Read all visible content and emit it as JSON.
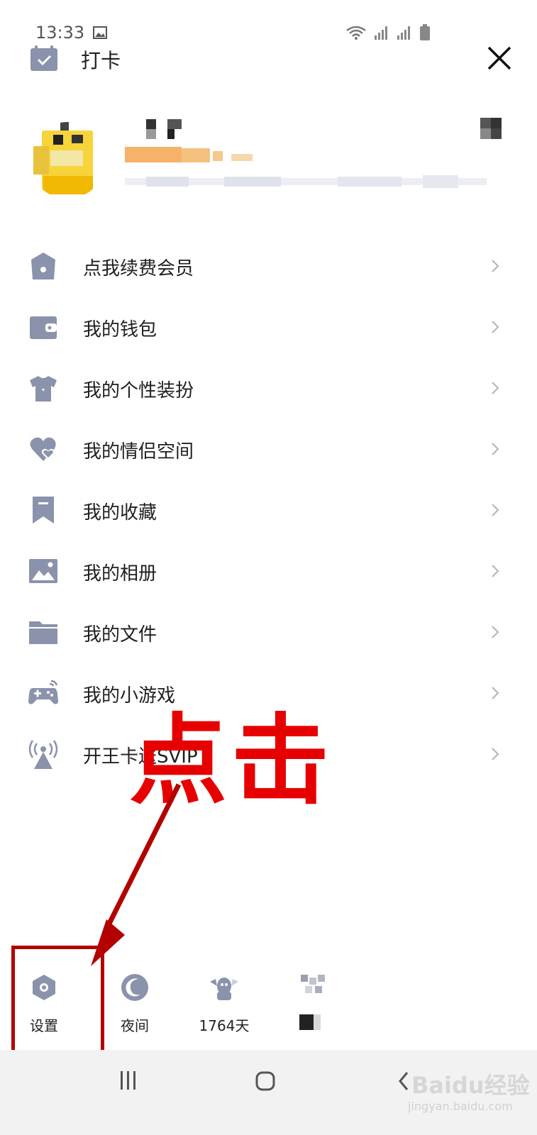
{
  "status_bar": {
    "time": "13:33",
    "icons": [
      "image-icon",
      "wifi-icon",
      "signal-icon",
      "signal-icon",
      "battery-icon"
    ]
  },
  "header": {
    "title": "打卡",
    "checkin_icon": "calendar-check-icon",
    "close_icon": "close-icon"
  },
  "profile": {
    "avatar_icon": "avatar"
  },
  "menu": {
    "items": [
      {
        "label": "点我续费会员",
        "icon": "crown-bag-icon"
      },
      {
        "label": "我的钱包",
        "icon": "wallet-icon"
      },
      {
        "label": "我的个性装扮",
        "icon": "tshirt-icon"
      },
      {
        "label": "我的情侣空间",
        "icon": "hearts-icon"
      },
      {
        "label": "我的收藏",
        "icon": "bookmark-icon"
      },
      {
        "label": "我的相册",
        "icon": "photo-icon"
      },
      {
        "label": "我的文件",
        "icon": "folder-icon"
      },
      {
        "label": "我的小游戏",
        "icon": "gamepad-icon"
      },
      {
        "label": "开王卡送SVIP",
        "icon": "broadcast-icon"
      }
    ]
  },
  "annotation": {
    "text": "点击",
    "color": "#e60000"
  },
  "quick_bar": {
    "settings_label": "设置",
    "night_label": "夜间",
    "days_label": "1764天"
  },
  "navbar": {
    "watermark": "Baidu经验",
    "watermark_sub": "jingyan.baidu.com"
  },
  "colors": {
    "icon_gray": "#8a93ab",
    "text": "#1f1f1f",
    "chevron": "#b7b7b7"
  }
}
